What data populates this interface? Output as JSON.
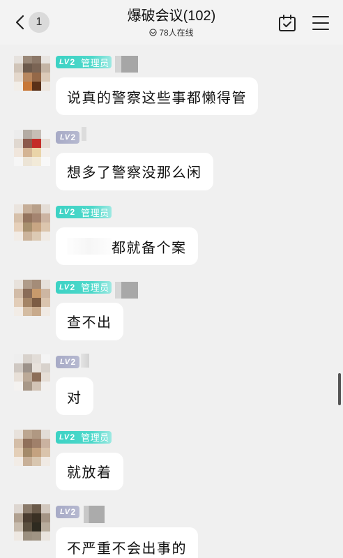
{
  "header": {
    "back_badge": "1",
    "title": "爆破会议(102)",
    "online": "78人在线"
  },
  "messages": [
    {
      "lv_prefix": "LV",
      "lv_num": "2",
      "role": "管理员",
      "text": "说真的警察这些事都懒得管"
    },
    {
      "lv_prefix": "LV",
      "lv_num": "2",
      "text": "想多了警察没那么闲"
    },
    {
      "lv_prefix": "LV",
      "lv_num": "2",
      "role": "管理员",
      "text": "都就备个案"
    },
    {
      "lv_prefix": "LV",
      "lv_num": "2",
      "role": "管理员",
      "text": "查不出"
    },
    {
      "lv_prefix": "LV",
      "lv_num": "2",
      "text": "对"
    },
    {
      "lv_prefix": "LV",
      "lv_num": "2",
      "role": "管理员",
      "text": "就放着"
    },
    {
      "lv_prefix": "LV",
      "lv_num": "2",
      "text": "不严重不会出事的"
    }
  ],
  "icons": {
    "back": "chevron-left-icon",
    "online": "online-status-icon",
    "calendar": "calendar-check-icon",
    "menu": "menu-icon"
  },
  "colors": {
    "background": "#f0f0f0",
    "header": "#f3f3f3",
    "bubble": "#ffffff",
    "admin_badge": "#3cd2c4",
    "level_badge": "#a7aac6",
    "text": "#111111"
  }
}
